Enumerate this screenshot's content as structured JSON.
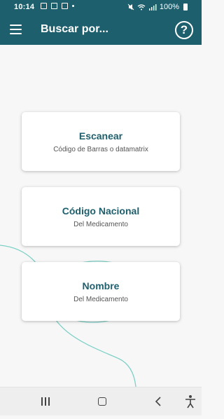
{
  "status_bar": {
    "time": "10:14",
    "battery_percent": "100%"
  },
  "app_bar": {
    "title": "Buscar por...",
    "help_glyph": "?"
  },
  "options": [
    {
      "title": "Escanear",
      "subtitle": "Código de Barras o datamatrix"
    },
    {
      "title": "Código Nacional",
      "subtitle": "Del Medicamento"
    },
    {
      "title": "Nombre",
      "subtitle": "Del Medicamento"
    }
  ],
  "icons": {
    "menu": "hamburger-menu-icon",
    "help": "question-circle-icon",
    "recents": "recents-icon",
    "home": "home-icon",
    "back": "back-chevron-icon",
    "accessibility": "accessibility-icon"
  },
  "colors": {
    "primary": "#1e5f6e",
    "decor_line": "#7fd1c6",
    "background": "#f7f7f7"
  }
}
